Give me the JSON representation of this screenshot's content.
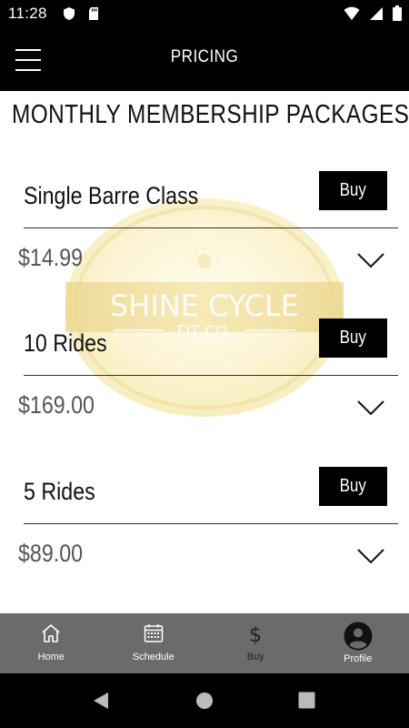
{
  "status_bar": {
    "time": "11:28"
  },
  "header": {
    "title": "PRICING"
  },
  "page": {
    "title": "MONTHLY MEMBERSHIP PACKAGES"
  },
  "watermark": {
    "line1": "SHINE CYCLE",
    "line2": "FIT CO."
  },
  "packages": [
    {
      "name": "Single Barre Class",
      "price": "$14.99",
      "buy_label": "Buy"
    },
    {
      "name": "10 Rides",
      "price": "$169.00",
      "buy_label": "Buy"
    },
    {
      "name": "5 Rides",
      "price": "$89.00",
      "buy_label": "Buy"
    }
  ],
  "bottom_nav": [
    {
      "label": "Home",
      "icon": "home-icon"
    },
    {
      "label": "Schedule",
      "icon": "calendar-icon"
    },
    {
      "label": "Buy",
      "icon": "dollar-icon"
    },
    {
      "label": "Profile",
      "icon": "profile-icon"
    }
  ]
}
